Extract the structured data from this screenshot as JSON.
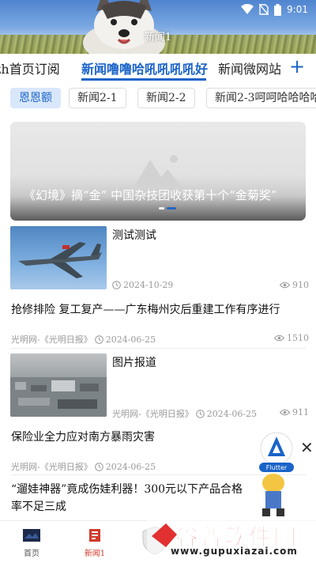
{
  "status": {
    "time": "9:01"
  },
  "header": {
    "title": "新闻1"
  },
  "tabs": [
    {
      "label": "zh首页订阅"
    },
    {
      "label": "新闻噜噜哈吼吼吼吼好"
    },
    {
      "label": "新闻微网站"
    }
  ],
  "add_tab_icon": "plus-icon",
  "subtabs": [
    {
      "label": "恩恩额"
    },
    {
      "label": "新闻2-1"
    },
    {
      "label": "新闻2-2"
    },
    {
      "label": "新闻2-3呵呵哈哈哈哈"
    }
  ],
  "banner": {
    "caption": "《幻境》摘“金” 中国杂技团收获第十个“金菊奖”"
  },
  "articles": [
    {
      "title": "测试测试",
      "date": "2024-10-29",
      "views": "910"
    },
    {
      "title": "抢修排险 复工复产——广东梅州灾后重建工作有序进行",
      "source": "光明网-《光明日报》",
      "date": "2024-06-25",
      "views": "1510"
    },
    {
      "title": "图片报道",
      "source": "光明网-《光明日报》",
      "date": "2024-06-25",
      "views": "911"
    },
    {
      "title": "保险业全力应对南方暴雨灾害",
      "source": "光明网-《光明日报》",
      "date": "2024-06-25"
    },
    {
      "title": "“遛娃神器”竟成伤娃利器！300元以下产品合格率不足三成"
    }
  ],
  "float_ad": {
    "label": "Flutter"
  },
  "bottom_nav": [
    {
      "label": "首页"
    },
    {
      "label": "新闻1"
    }
  ],
  "watermark": {
    "text": "谷普软件园",
    "url": "www.gupuxiazai.com"
  },
  "colors": {
    "accent": "#1a63c8",
    "nav_active": "#d03b2c"
  }
}
